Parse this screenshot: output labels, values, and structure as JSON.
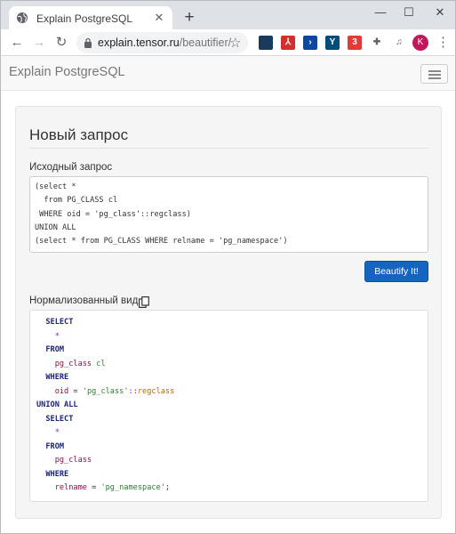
{
  "browser": {
    "tab_title": "Explain PostgreSQL",
    "url_host": "explain.tensor.ru",
    "url_path": "/beautifier/",
    "avatar_letter": "K",
    "extensions": [
      {
        "name": "extension-1-icon",
        "glyph": "",
        "color": "#1a3a5c"
      },
      {
        "name": "pdf-extension-icon",
        "glyph": "⅄",
        "color": "#d32f2f"
      },
      {
        "name": "extension-3-icon",
        "glyph": "›",
        "color": "#0d47a1"
      },
      {
        "name": "extension-4-icon",
        "glyph": "Y",
        "color": "#004d7a"
      },
      {
        "name": "extension-5-icon",
        "glyph": "3",
        "color": "#e53935"
      },
      {
        "name": "puzzle-icon",
        "glyph": "✚",
        "color": "#5f6368"
      },
      {
        "name": "media-icon",
        "glyph": "♫",
        "color": "#5f6368"
      }
    ]
  },
  "page": {
    "brand": "Explain PostgreSQL",
    "panel_title": "Новый запрос",
    "input_label": "Исходный запрос",
    "input_value": "(select *\n  from PG_CLASS cl\n WHERE oid = 'pg_class'::regclass)\nUNION ALL\n(select * from PG_CLASS WHERE relname = 'pg_namespace')",
    "beautify_button": "Beautify It!",
    "output_label": "Нормализованный вид"
  },
  "output": [
    {
      "indent": "  ",
      "tokens": [
        {
          "t": "SELECT",
          "c": "kw"
        }
      ]
    },
    {
      "indent": "    ",
      "tokens": [
        {
          "t": "*",
          "c": "op"
        }
      ]
    },
    {
      "indent": "  ",
      "tokens": [
        {
          "t": "FROM",
          "c": "kw"
        }
      ]
    },
    {
      "indent": "    ",
      "tokens": [
        {
          "t": "pg_class",
          "c": "id"
        },
        {
          "t": " ",
          "c": ""
        },
        {
          "t": "cl",
          "c": "col"
        }
      ]
    },
    {
      "indent": "  ",
      "tokens": [
        {
          "t": "WHERE",
          "c": "kw"
        }
      ]
    },
    {
      "indent": "    ",
      "tokens": [
        {
          "t": "oid",
          "c": "id"
        },
        {
          "t": " = ",
          "c": ""
        },
        {
          "t": "'pg_class'",
          "c": "str"
        },
        {
          "t": "::",
          "c": "op"
        },
        {
          "t": "regclass",
          "c": "typ"
        }
      ]
    },
    {
      "indent": "",
      "tokens": [
        {
          "t": "UNION ALL",
          "c": "kw"
        }
      ]
    },
    {
      "indent": "  ",
      "tokens": [
        {
          "t": "SELECT",
          "c": "kw"
        }
      ]
    },
    {
      "indent": "    ",
      "tokens": [
        {
          "t": "*",
          "c": "op"
        }
      ]
    },
    {
      "indent": "  ",
      "tokens": [
        {
          "t": "FROM",
          "c": "kw"
        }
      ]
    },
    {
      "indent": "    ",
      "tokens": [
        {
          "t": "pg_class",
          "c": "id"
        }
      ]
    },
    {
      "indent": "  ",
      "tokens": [
        {
          "t": "WHERE",
          "c": "kw"
        }
      ]
    },
    {
      "indent": "    ",
      "tokens": [
        {
          "t": "relname",
          "c": "id"
        },
        {
          "t": " = ",
          "c": ""
        },
        {
          "t": "'pg_namespace'",
          "c": "str"
        },
        {
          "t": ";",
          "c": ""
        }
      ]
    }
  ]
}
